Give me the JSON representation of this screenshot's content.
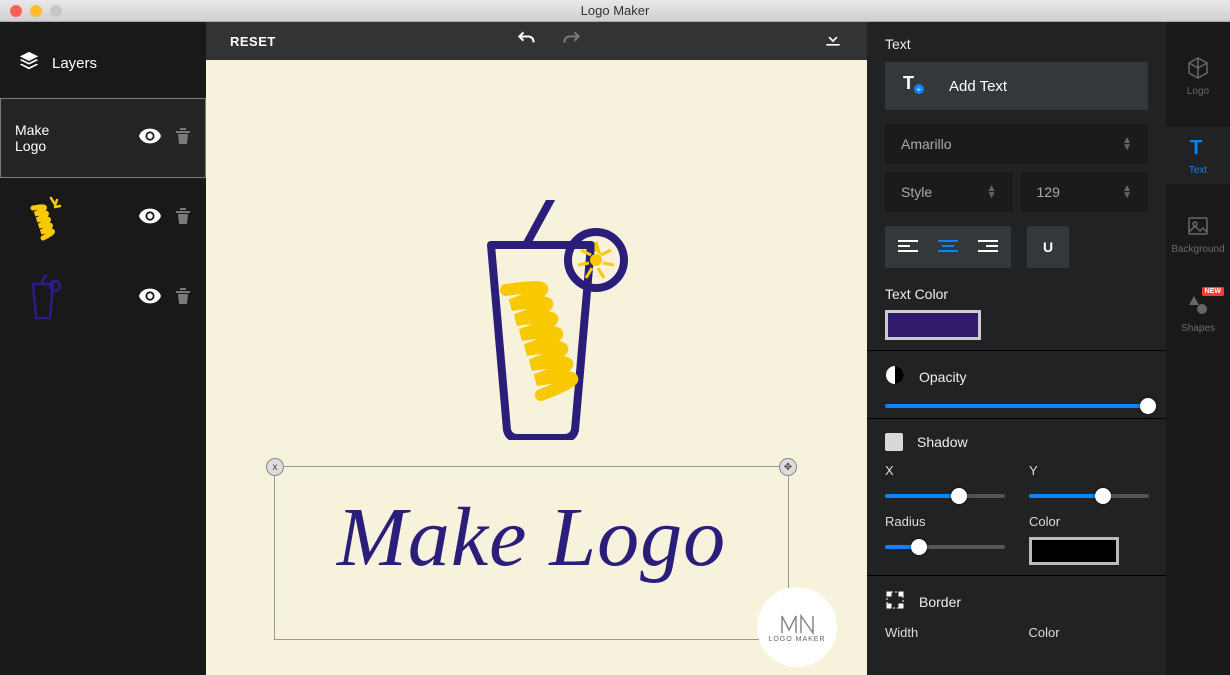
{
  "window": {
    "title": "Logo Maker"
  },
  "left": {
    "header": "Layers",
    "layers": [
      {
        "type": "text",
        "label": "Make Logo",
        "selected": true
      },
      {
        "type": "scribble",
        "selected": false
      },
      {
        "type": "glass",
        "selected": false
      }
    ]
  },
  "toolbar": {
    "reset": "RESET"
  },
  "canvas": {
    "text": "Make Logo",
    "watermark": "LOGO MAKER"
  },
  "right": {
    "textHeader": "Text",
    "addText": "Add Text",
    "font": "Amarillo",
    "styleLabel": "Style",
    "sizeValue": "129",
    "underline": "U",
    "textColorLabel": "Text Color",
    "textColor": "#2f1a6b",
    "opacityLabel": "Opacity",
    "opacityValue": 100,
    "shadowLabel": "Shadow",
    "shadow": {
      "xLabel": "X",
      "yLabel": "Y",
      "radiusLabel": "Radius",
      "colorLabel": "Color",
      "color": "#000000"
    },
    "borderLabel": "Border",
    "border": {
      "widthLabel": "Width",
      "colorLabel": "Color"
    }
  },
  "tabs": {
    "logo": "Logo",
    "text": "Text",
    "background": "Background",
    "shapes": "Shapes",
    "newBadge": "NEW"
  }
}
